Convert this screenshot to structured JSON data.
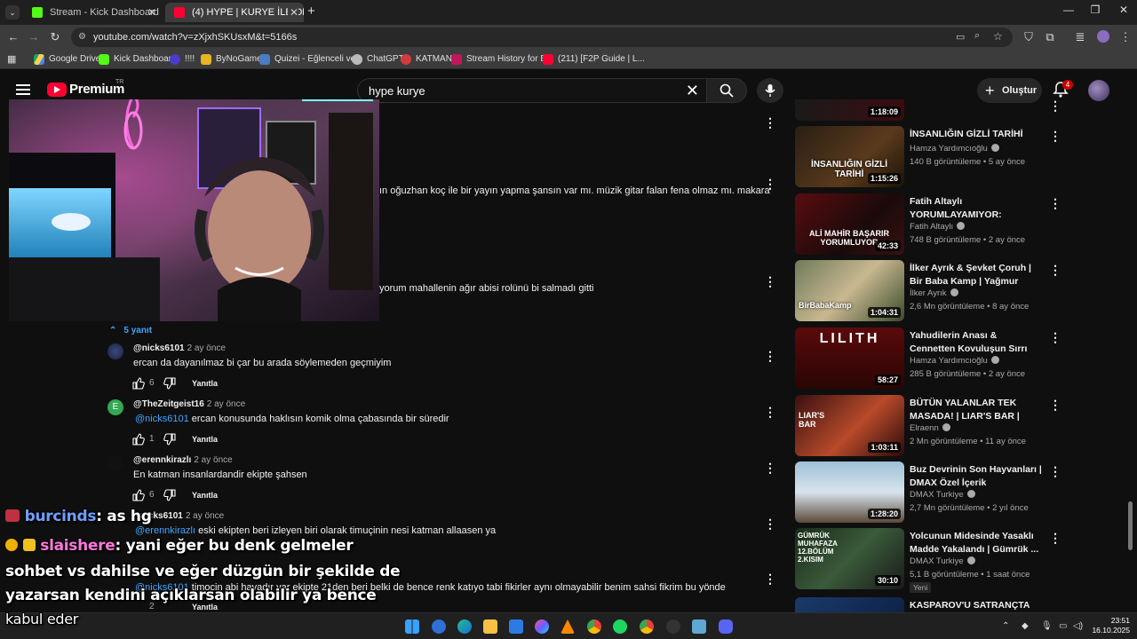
{
  "browser": {
    "tabs": [
      {
        "label": "Stream - Kick Dashboard",
        "active": false
      },
      {
        "label": "(4) HYPE | KURYE İLE OLAYLI TO",
        "active": true
      }
    ],
    "url": "youtube.com/watch?v=zXjxhSKUsxM&t=5166s",
    "bookmarks": [
      "Google Drive",
      "Kick Dashboard",
      "!!!!",
      "ByNoGame",
      "Quizei - Eğlenceli ve...",
      "ChatGPT",
      "KATMAN",
      "Stream History for B...",
      "(211) [F2P Guide | L..."
    ]
  },
  "youtube": {
    "logo_text": "Premium",
    "region": "TR",
    "search_query": "hype kurye",
    "create_label": "Oluştur",
    "notif_count": "4"
  },
  "comments": {
    "partial_lines": [
      "ın oğuzhan koç ile bir yayın yapma şansın var mı. müzik gitar falan fena olmaz mı. makara",
      "yorum mahallenin ağır abisi rolünü bi salmadı gitti"
    ],
    "replies_toggle": "5 yanıt",
    "reply_label": "Yanıtla",
    "replies": [
      {
        "handle": "@nicks6101",
        "age": "2 ay önce",
        "mention": "",
        "text": "ercan da dayanılmaz bi çar bu arada söylemeden geçmiyim",
        "likes": "6"
      },
      {
        "handle": "@TheZeitgeist16",
        "age": "2 ay önce",
        "mention": "@nicks6101",
        "text": "ercan konusunda haklısın komik olma çabasında bir süredir",
        "likes": "1"
      },
      {
        "handle": "@erennkirazlı",
        "age": "2 ay önce",
        "mention": "",
        "text": "En katman insanlardandir ekipte şahsen",
        "likes": "6"
      },
      {
        "handle": "nicks6101",
        "age": "2 ay önce",
        "mention": "@erennkirazlı",
        "text": "eski ekipten beri izleyen biri olarak timuçinin nesi katman allaasen ya",
        "likes": ""
      },
      {
        "handle": "",
        "age": "",
        "mention": "@nicks6101",
        "text": "timocin abi hayadır var ekipte 21den beri belki de bence renk katıyo tabi fikirler aynı olmayabilir benim sahsi fikrim bu yönde",
        "likes": "2"
      }
    ]
  },
  "sidebar": {
    "videos": [
      {
        "title": "",
        "channel": "",
        "meta": "",
        "duration": "1:18:09"
      },
      {
        "title": "İNSANLIĞIN GİZLİ TARİHİ",
        "channel": "Hamza Yardımcıoğlu",
        "meta": "140 B görüntüleme • 5 ay önce",
        "duration": "1:15:26",
        "thumb_text": "İNSANLIĞIN GİZLİ TARİHİ"
      },
      {
        "title": "Fatih Altaylı YORUMLAYAMIYOR: \"Diploma\"...",
        "channel": "Fatih Altaylı",
        "meta": "748 B görüntüleme • 2 ay önce",
        "duration": "42:33",
        "thumb_text": "ALİ MAHİR BAŞARIR YORUMLUYOR"
      },
      {
        "title": "İlker Ayrık & Şevket Çoruh | Bir Baba Kamp | Yağmur Dinmedi,...",
        "channel": "İlker Ayrık",
        "meta": "2,6 Mn görüntüleme • 8 ay önce",
        "duration": "1:04:31",
        "thumb_text": "BirBabaKamp"
      },
      {
        "title": "Yahudilerin Anası & Cennetten Kovuluşun Sırrı",
        "channel": "Hamza Yardımcıoğlu",
        "meta": "285 B görüntüleme • 2 ay önce",
        "duration": "58:27",
        "thumb_text": "LILITH"
      },
      {
        "title": "BÜTÜN YALANLAR TEK MASADA! | LIAR'S BAR |",
        "channel": "Elraenn",
        "meta": "2 Mn görüntüleme • 11 ay önce",
        "duration": "1:03:11",
        "thumb_text": "LIAR'S BAR"
      },
      {
        "title": "Buz Devrinin Son Hayvanları | DMAX Özel İçerik",
        "channel": "DMAX Turkiye",
        "meta": "2,7 Mn görüntüleme • 2 yıl önce",
        "duration": "1:28:20",
        "thumb_text": ""
      },
      {
        "title": "Yolcunun Midesinde Yasaklı Madde Yakalandı | Gümrük ...",
        "channel": "DMAX Turkiye",
        "meta": "5,1 B görüntüleme • 1 saat önce",
        "duration": "30:10",
        "badge": "Yeni",
        "thumb_text": "GÜMRÜK MUHAFAZA 12.BÖLÜM 2.KISIM"
      },
      {
        "title": "KASPAROV'U SATRANÇTA",
        "channel": "",
        "meta": "",
        "duration": ""
      }
    ]
  },
  "stream_chat": [
    {
      "user": "burcinds",
      "text": ": as hg"
    },
    {
      "user": "slaishere",
      "text": ": yani eğer bu denk gelmeler"
    },
    {
      "user": "",
      "text": "sohbet vs dahilse ve eğer düzgün bir şekilde de"
    },
    {
      "user": "",
      "text": "yazarsan kendini açıklarsan olabilir ya bence"
    },
    {
      "user": "",
      "text": "kabul eder"
    }
  ],
  "taskbar": {
    "time": "23:51",
    "date": "16.10.2025"
  },
  "colors": {
    "youtube_red": "#ff0033",
    "link_blue": "#3ea6ff",
    "kick_green": "#53fc18",
    "chat_user_blue": "#6fa0ff"
  }
}
